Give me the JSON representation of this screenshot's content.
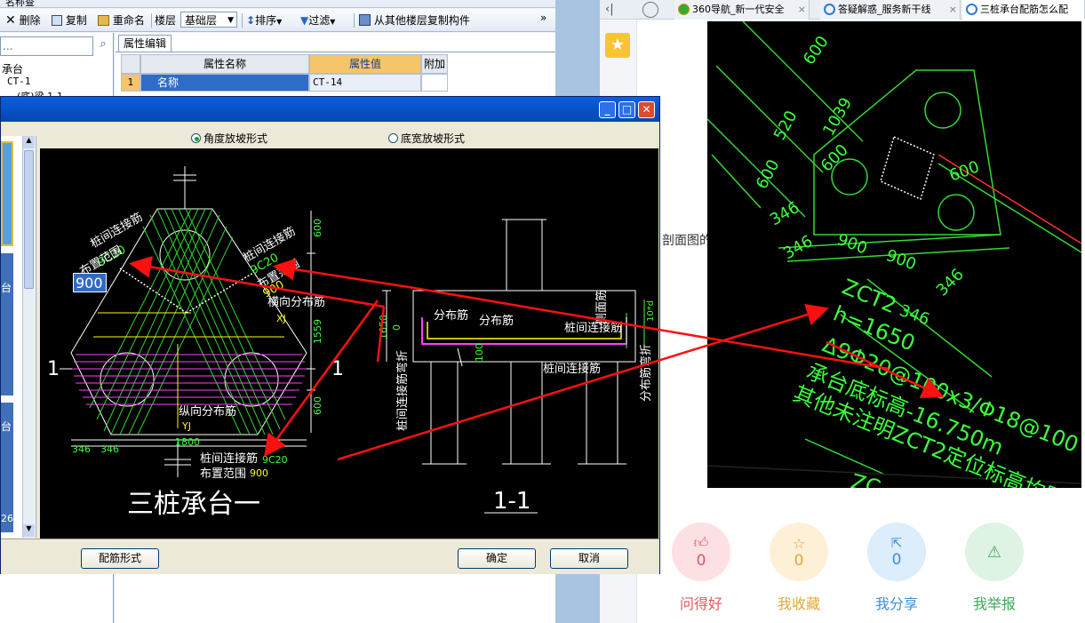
{
  "toolbar": {
    "partial_top": "名称查",
    "delete_label": "删除",
    "copy_label": "复制",
    "rename_label": "重命名",
    "floor_label": "楼层",
    "floor_value": "基础层",
    "sort_label": "排序",
    "filter_label": "过滤",
    "copy_from_floor_label": "从其他楼层复制构件",
    "more": "»"
  },
  "left_panel": {
    "search_placeholder": "...",
    "tree": [
      "承台",
      "CT-1",
      "…(底)梁 1-1"
    ]
  },
  "property_editor": {
    "tab_label": "属性编辑",
    "col_name": "属性名称",
    "col_value": "属性值",
    "col_extra": "附加",
    "rows": [
      {
        "num": "1",
        "name": "名称",
        "value": "CT-14"
      }
    ]
  },
  "dialog": {
    "radio_angle": "角度放坡形式",
    "radio_width": "底宽放坡形式",
    "left_labels": [
      "台",
      "台",
      "26"
    ],
    "btn_config": "配筋形式",
    "btn_ok": "确定",
    "btn_cancel": "取消",
    "edit_value": "900",
    "cad": {
      "title_main": "三桩承台一",
      "title_section": "1-1",
      "sec_mark_1": "1",
      "sec_mark_2": "1",
      "lbl_pile_link_1": "桩间连接筋",
      "lbl_9c20_1": "9C20",
      "lbl_range_1": "布置范围",
      "lbl_pile_link_2": "桩间连接筋",
      "lbl_9c20_2": "9C20",
      "lbl_range_2": "布置范围",
      "lbl_900_2": "900",
      "lbl_trans": "横向分布筋",
      "lbl_xj": "XJ",
      "lbl_long": "纵向分布筋",
      "lbl_yj": "YJ",
      "lbl_pile_link_3": "桩间连接筋",
      "lbl_9c20_3": "9C20",
      "lbl_range_3": "布置范围",
      "lbl_900_3": "900",
      "dim_346a": "346",
      "dim_346b": "346",
      "dim_1800": "1800",
      "dim_600a": "600",
      "dim_1559": "1559",
      "dim_600b": "600",
      "s_dist_1": "分布筋",
      "s_dist_2": "分布筋",
      "s_side": "侧面筋",
      "s_link_1": "桩间连接筋",
      "s_link_2": "桩间连接筋",
      "s_bend": "桩间连接筋弯折",
      "s_dist_bend": "分布筋弯折",
      "s_1650": "1650",
      "s_100": "100",
      "s_0": "0",
      "s_10d": "10*d"
    }
  },
  "browser": {
    "tabs": [
      "360导航_新一代安全",
      "答疑解惑_服务新干线",
      "三桩承台配筋怎么配"
    ],
    "partial_text": "剖面图的",
    "photo": {
      "d600": "600",
      "d520": "520",
      "d1039": "1039",
      "d600b": "600",
      "d600c": "600",
      "d600d": "600",
      "d346a": "346",
      "d346b": "346",
      "d900a": "900",
      "d900b": "900",
      "d346c": "346",
      "d346d": "346",
      "line1": "ZCT2",
      "line2": "h=1650",
      "line3": "Δ9Φ20@100x3/Φ18@100",
      "line4": "承台底标高-16.750m",
      "line5": "其他未注明ZCT2定位标高均同",
      "cut": "ZC"
    },
    "actions": [
      {
        "count": "0",
        "label": "问得好",
        "icon": "thumbs-up-icon"
      },
      {
        "count": "0",
        "label": "我收藏",
        "icon": "star-icon"
      },
      {
        "count": "0",
        "label": "我分享",
        "icon": "share-icon"
      },
      {
        "count": "0",
        "label": "我举报",
        "icon": "warning-icon"
      }
    ]
  },
  "colors": {
    "cad_green": "#3cff3c",
    "cad_yellow": "#ffff00",
    "cad_magenta": "#ff40ff",
    "arrow_red": "#ff1010",
    "xp_blue": "#0a5fe0"
  }
}
